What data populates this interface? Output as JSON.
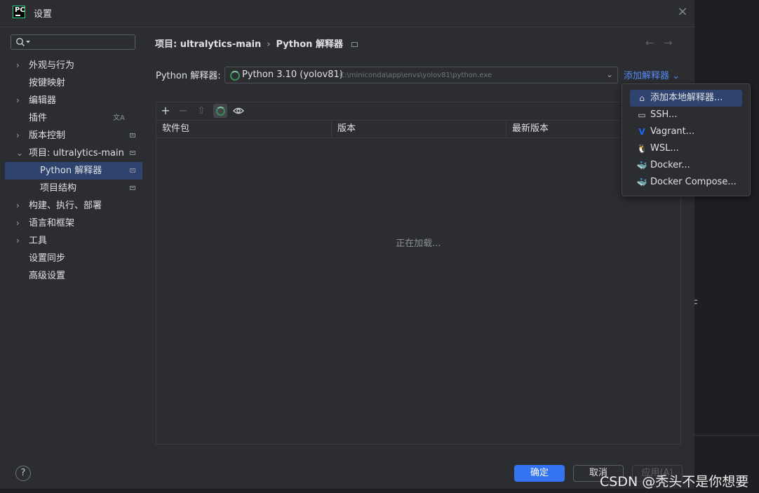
{
  "dialog": {
    "title": "设置",
    "app_icon_text": "PC"
  },
  "search": {
    "placeholder": "",
    "value": ""
  },
  "sidebar": {
    "items": [
      {
        "label": "外观与行为",
        "expandable": true
      },
      {
        "label": "按键映射",
        "expandable": false
      },
      {
        "label": "编辑器",
        "expandable": true
      },
      {
        "label": "插件",
        "expandable": false
      },
      {
        "label": "版本控制",
        "expandable": true
      },
      {
        "label": "项目: ultralytics-main",
        "expandable": true,
        "expanded": true
      },
      {
        "label": "Python 解释器",
        "child": true,
        "selected": true
      },
      {
        "label": "项目结构",
        "child": true
      },
      {
        "label": "构建、执行、部署",
        "expandable": true
      },
      {
        "label": "语言和框架",
        "expandable": true
      },
      {
        "label": "工具",
        "expandable": true
      },
      {
        "label": "设置同步",
        "expandable": false
      },
      {
        "label": "高级设置",
        "expandable": false
      }
    ]
  },
  "breadcrumb": {
    "parent": "项目: ultralytics-main",
    "separator": "›",
    "current": "Python 解释器"
  },
  "nav": {
    "back": "←",
    "forward": "→"
  },
  "interpreter": {
    "label": "Python 解释器:",
    "name": "Python 3.10 (yolov81)",
    "path": "C:\\miniconda\\app\\envs\\yolov81\\python.exe",
    "add_label": "添加解释器",
    "add_chevron": "⌄"
  },
  "packages": {
    "toolbar": {
      "add": "+",
      "remove": "−",
      "upgrade": "⇧",
      "show": "👁"
    },
    "columns": [
      "软件包",
      "版本",
      "最新版本"
    ],
    "loading_text": "正在加载..."
  },
  "add_interpreter_menu": {
    "items": [
      {
        "label": "添加本地解释器...",
        "icon": "home-icon",
        "glyph": "⌂",
        "highlighted": true
      },
      {
        "label": "SSH...",
        "icon": "terminal-icon",
        "glyph": "▭"
      },
      {
        "label": "Vagrant...",
        "icon": "vagrant-icon",
        "glyph": "V"
      },
      {
        "label": "WSL...",
        "icon": "linux-icon",
        "glyph": "🐧"
      },
      {
        "label": "Docker...",
        "icon": "docker-icon",
        "glyph": "🐳"
      },
      {
        "label": "Docker Compose...",
        "icon": "docker-icon",
        "glyph": "🐳"
      }
    ]
  },
  "footer": {
    "help": "?",
    "ok": "确定",
    "cancel": "取消",
    "apply": "应用(A)"
  },
  "watermark": "CSDN @秃头不是你想要",
  "colors": {
    "accent": "#3574f0",
    "selection": "#2e436e",
    "link": "#548af7",
    "background": "#2b2d30"
  }
}
